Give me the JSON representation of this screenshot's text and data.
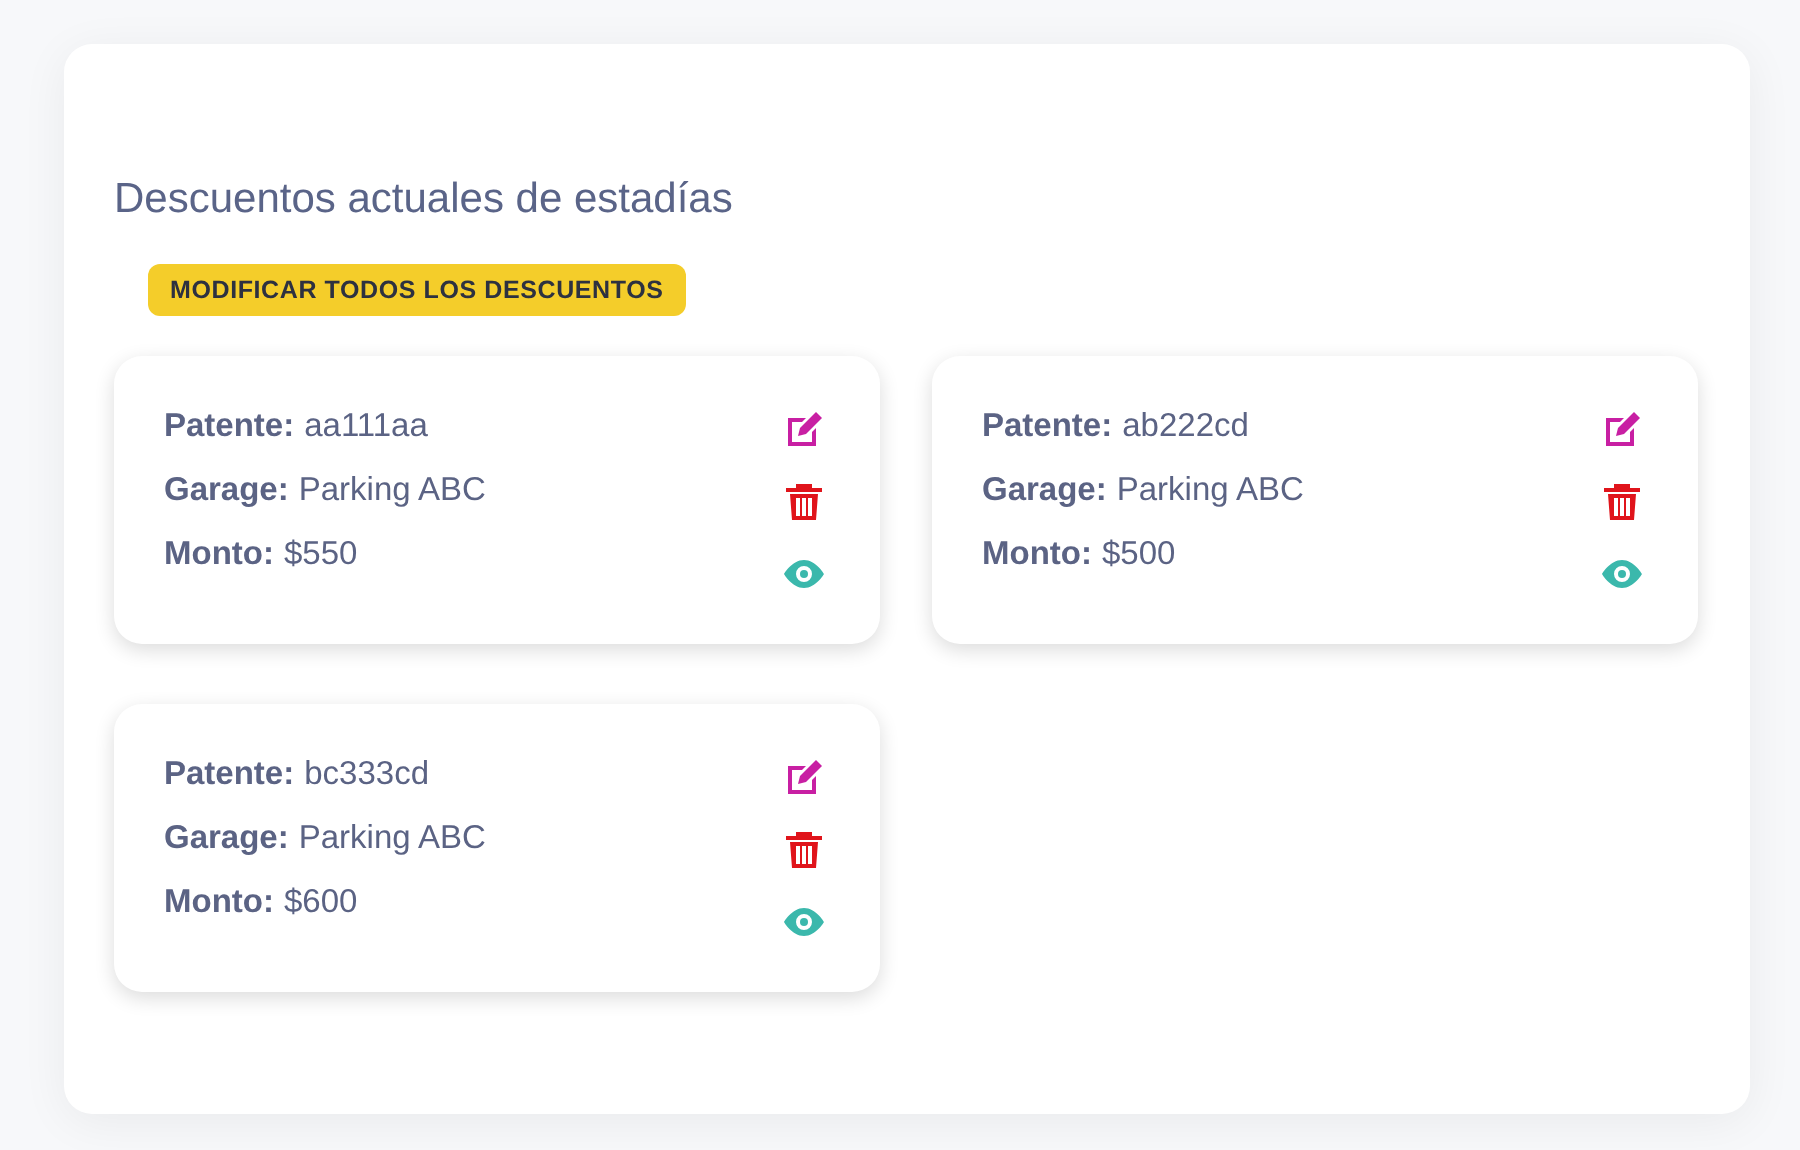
{
  "title": "Descuentos actuales de estadías",
  "action_button": "MODIFICAR TODOS LOS DESCUENTOS",
  "cards": [
    {
      "fields": [
        {
          "label": "Patente:",
          "value": "aa111aa"
        },
        {
          "label": "Garage:",
          "value": "Parking ABC"
        },
        {
          "label": "Monto:",
          "value": "$550"
        }
      ]
    },
    {
      "fields": [
        {
          "label": "Patente:",
          "value": "ab222cd"
        },
        {
          "label": "Garage:",
          "value": "Parking ABC"
        },
        {
          "label": "Monto:",
          "value": "$500"
        }
      ]
    },
    {
      "fields": [
        {
          "label": "Patente:",
          "value": "bc333cd"
        },
        {
          "label": "Garage:",
          "value": "Parking ABC"
        },
        {
          "label": "Monto:",
          "value": "$600"
        }
      ]
    }
  ]
}
